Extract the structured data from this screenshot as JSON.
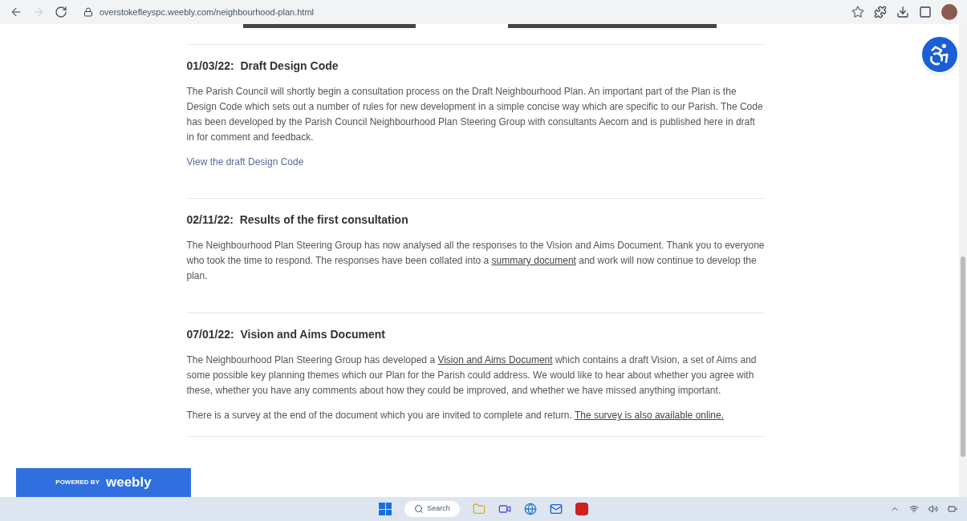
{
  "browser": {
    "url": "overstokefleyspc.weebly.com/neighbourhood-plan.html"
  },
  "posts": [
    {
      "title": "01/03/22:  Draft Design Code",
      "paragraphs": [
        [
          "The Parish Council will shortly begin a consultation process on the Draft Neighbourhood Plan. An important part of the Plan is the Design Code which sets out a number of rules for new development in a simple concise way which are specific to our Parish. The Code has been developed by the Parish Council Neighbourhood Plan Steering Group with consultants Aecom and is published here in draft in for comment and feedback."
        ]
      ],
      "link": "View the draft Design Code"
    },
    {
      "title": "02/11/22:  Results of the first consultation",
      "paragraphs": [
        [
          "The Neighbourhood Plan Steering Group has now analysed all the responses to the Vision and Aims Document. Thank you to everyone who took the time to respond.  The responses have been collated into a ",
          {
            "link": "summary document"
          },
          " and work will now continue to develop the plan."
        ]
      ]
    },
    {
      "title": "07/01/22:  Vision and Aims Document",
      "paragraphs": [
        [
          "The Neighbourhood Plan Steering Group has developed a ",
          {
            "link": "Vision and Aims Document"
          },
          " which contains a draft Vision, a set of Aims and some possible key planning themes which our Plan for the Parish could address.  We would like to hear about whether you agree with these, whether you have any comments about how they could be improved, and whether we have missed anything important."
        ],
        [
          "There is a survey at the end of the document which you are invited to complete and return.  ",
          {
            "link": "The survey is also available online."
          }
        ]
      ]
    }
  ],
  "badge": {
    "prefix": "POWERED BY",
    "brand": "weebly"
  },
  "taskbar": {
    "search": "Search"
  }
}
